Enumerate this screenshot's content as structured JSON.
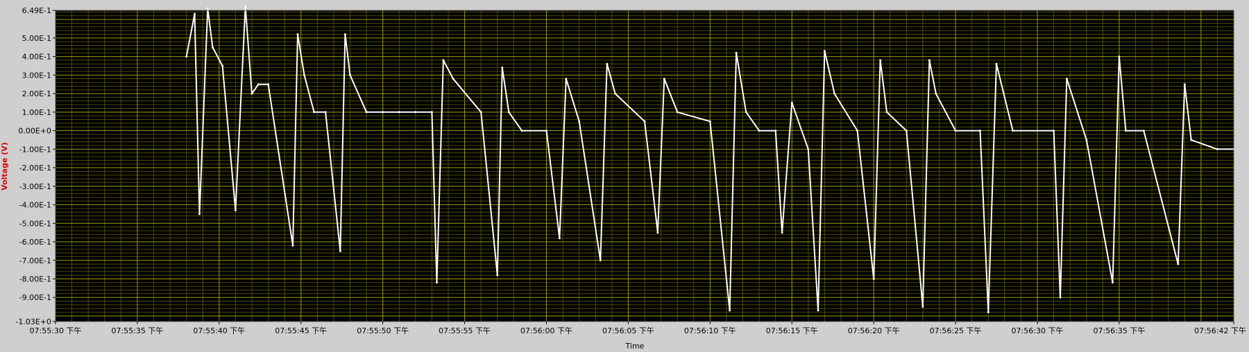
{
  "chart_data": {
    "type": "line",
    "title": "",
    "xlabel": "Time",
    "ylabel": "Voltage (V)",
    "xlim": [
      "07:55:30 下午",
      "07:56:42 下午"
    ],
    "ylim": [
      -1.03,
      0.649
    ],
    "y_ticks": [
      "6.49E-1",
      "5.00E-1",
      "4.00E-1",
      "3.00E-1",
      "2.00E-1",
      "1.00E-1",
      "0.00E+0",
      "-1.00E-1",
      "-2.00E-1",
      "-3.00E-1",
      "-4.00E-1",
      "-5.00E-1",
      "-6.00E-1",
      "-7.00E-1",
      "-8.00E-1",
      "-9.00E-1",
      "-1.03E+0"
    ],
    "x_ticks": [
      "07:55:30 下午",
      "07:55:35 下午",
      "07:55:40 下午",
      "07:55:45 下午",
      "07:55:50 下午",
      "07:55:55 下午",
      "07:56:00 下午",
      "07:56:05 下午",
      "07:56:10 下午",
      "07:56:15 下午",
      "07:56:20 下午",
      "07:56:25 下午",
      "07:56:30 下午",
      "07:56:35 下午",
      "07:56:42 下午"
    ],
    "grid": true,
    "series": [
      {
        "x": [
          "07:55:38.0",
          "07:55:38.5",
          "07:55:38.8",
          "07:55:39.3",
          "07:55:39.6",
          "07:55:40.2",
          "07:55:41.0",
          "07:55:41.6",
          "07:55:42.0",
          "07:55:42.4",
          "07:55:43.0",
          "07:55:44.5",
          "07:55:44.8",
          "07:55:45.2",
          "07:55:45.8",
          "07:55:46.5",
          "07:55:47.4",
          "07:55:47.7",
          "07:55:48.0",
          "07:55:49.0",
          "07:55:50.0",
          "07:55:51.0",
          "07:55:52.0",
          "07:55:53.0",
          "07:55:53.3",
          "07:55:53.7",
          "07:55:54.3",
          "07:55:56.0",
          "07:55:57.0",
          "07:55:57.3",
          "07:55:57.7",
          "07:55:58.5",
          "07:56:00.0",
          "07:56:00.8",
          "07:56:01.2",
          "07:56:02.0",
          "07:56:03.3",
          "07:56:03.7",
          "07:56:04.2",
          "07:56:06.0",
          "07:56:06.8",
          "07:56:07.2",
          "07:56:08.0",
          "07:56:10.0",
          "07:56:11.2",
          "07:56:11.6",
          "07:56:12.2",
          "07:56:13.0",
          "07:56:14.0",
          "07:56:14.4",
          "07:56:15.0",
          "07:56:16.0",
          "07:56:16.6",
          "07:56:17.0",
          "07:56:17.6",
          "07:56:19.0",
          "07:56:20.0",
          "07:56:20.4",
          "07:56:20.8",
          "07:56:22.0",
          "07:56:23.0",
          "07:56:23.4",
          "07:56:23.8",
          "07:56:25.0",
          "07:56:26.5",
          "07:56:27.0",
          "07:56:27.5",
          "07:56:28.5",
          "07:56:31.0",
          "07:56:31.4",
          "07:56:31.8",
          "07:56:33.0",
          "07:56:34.6",
          "07:56:35.0",
          "07:56:35.4",
          "07:56:36.5",
          "07:56:38.6",
          "07:56:39.0",
          "07:56:39.4",
          "07:56:41.0",
          "07:56:42.0"
        ],
        "y": [
          0.4,
          0.63,
          -0.45,
          0.66,
          0.45,
          0.35,
          -0.43,
          0.67,
          0.2,
          0.25,
          0.25,
          -0.62,
          0.52,
          0.3,
          0.1,
          0.1,
          -0.65,
          0.52,
          0.3,
          0.1,
          0.1,
          0.1,
          0.1,
          0.1,
          -0.82,
          0.38,
          0.28,
          0.1,
          -0.78,
          0.34,
          0.1,
          0.0,
          0.0,
          -0.58,
          0.28,
          0.05,
          -0.7,
          0.36,
          0.2,
          0.05,
          -0.55,
          0.28,
          0.1,
          0.05,
          -0.97,
          0.42,
          0.1,
          0.0,
          0.0,
          -0.55,
          0.15,
          -0.1,
          -0.97,
          0.43,
          0.2,
          0.0,
          -0.8,
          0.38,
          0.1,
          0.0,
          -0.95,
          0.38,
          0.2,
          0.0,
          0.0,
          -0.98,
          0.36,
          0.0,
          0.0,
          -0.9,
          0.28,
          -0.05,
          -0.82,
          0.4,
          0.0,
          0.0,
          -0.72,
          0.25,
          -0.05,
          -0.1,
          -0.1
        ]
      }
    ]
  }
}
